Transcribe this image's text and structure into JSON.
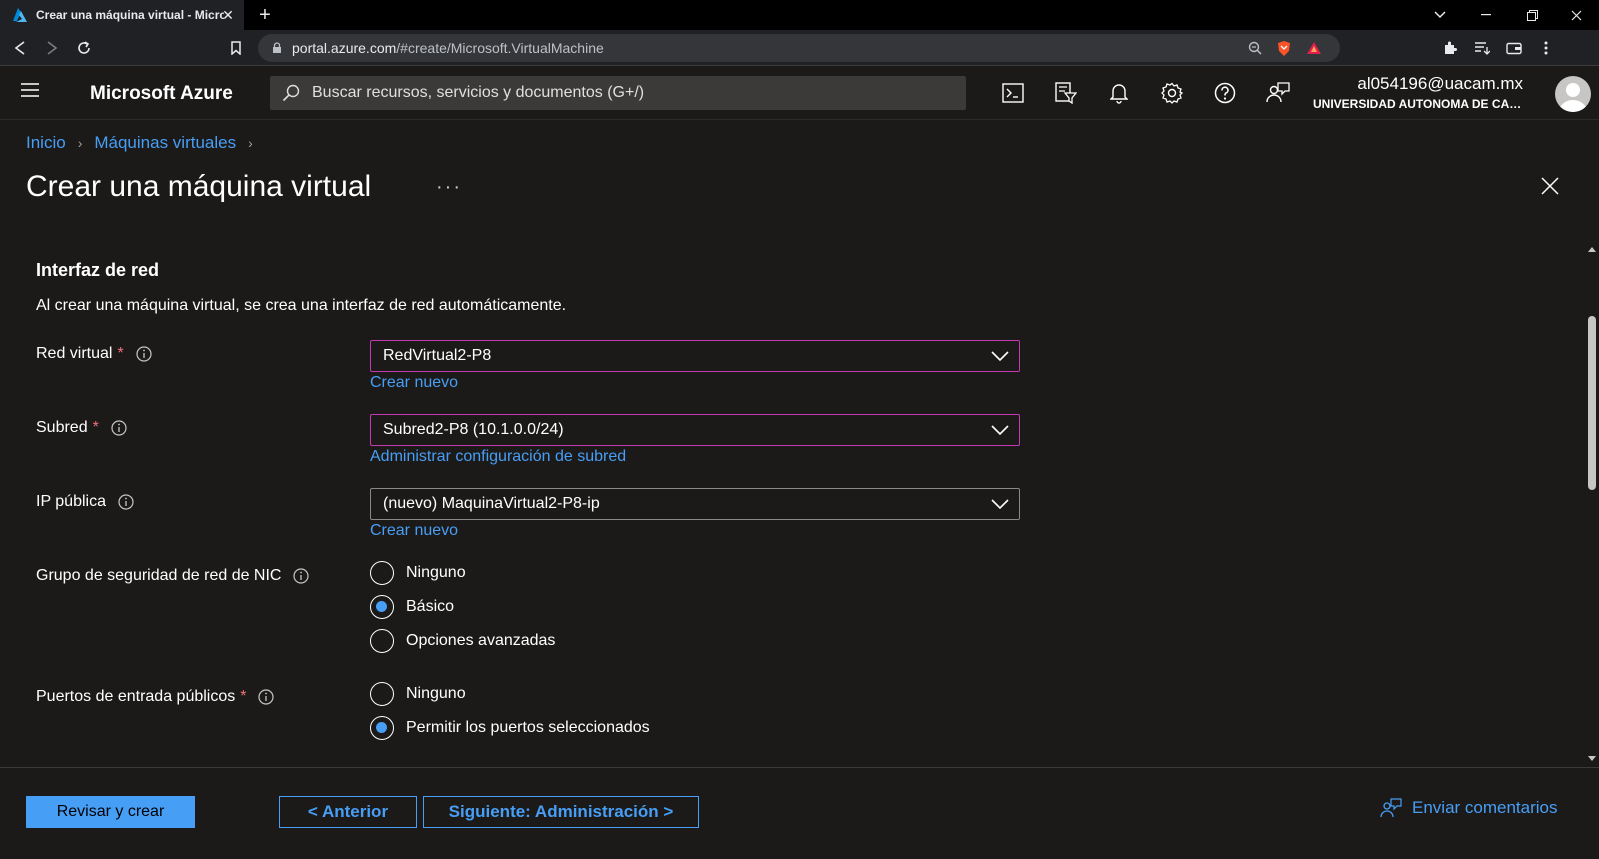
{
  "browser": {
    "tab_title": "Crear una máquina virtual - Microsoft Azure",
    "url_host": "portal.azure.com",
    "url_path": "/#create/Microsoft.VirtualMachine"
  },
  "header": {
    "brand": "Microsoft Azure",
    "search_placeholder": "Buscar recursos, servicios y documentos (G+/)",
    "account_email": "al054196@uacam.mx",
    "account_org": "UNIVERSIDAD AUTONOMA DE CAMPECHE"
  },
  "breadcrumb": [
    {
      "label": "Inicio"
    },
    {
      "label": "Máquinas virtuales"
    }
  ],
  "page_title": "Crear una máquina virtual",
  "section": {
    "title": "Interfaz de red",
    "description": "Al crear una máquina virtual, se crea una interfaz de red automáticamente."
  },
  "fields": {
    "vnet": {
      "label": "Red virtual",
      "value": "RedVirtual2-P8",
      "link": "Crear nuevo"
    },
    "subnet": {
      "label": "Subred",
      "value": "Subred2-P8 (10.1.0.0/24)",
      "link": "Administrar configuración de subred"
    },
    "public_ip": {
      "label": "IP pública",
      "value": "(nuevo) MaquinaVirtual2-P8-ip",
      "link": "Crear nuevo"
    },
    "nsg": {
      "label": "Grupo de seguridad de red de NIC",
      "options": [
        "Ninguno",
        "Básico",
        "Opciones avanzadas"
      ],
      "selected": "Básico"
    },
    "inbound_ports": {
      "label": "Puertos de entrada públicos",
      "options": [
        "Ninguno",
        "Permitir los puertos seleccionados"
      ],
      "selected": "Permitir los puertos seleccionados"
    }
  },
  "footer": {
    "review_create": "Revisar y crear",
    "previous": "< Anterior",
    "next": "Siguiente: Administración >",
    "feedback": "Enviar comentarios"
  },
  "colors": {
    "accent": "#479ef5",
    "focus_border": "#c239b3",
    "required": "#f1707b"
  }
}
